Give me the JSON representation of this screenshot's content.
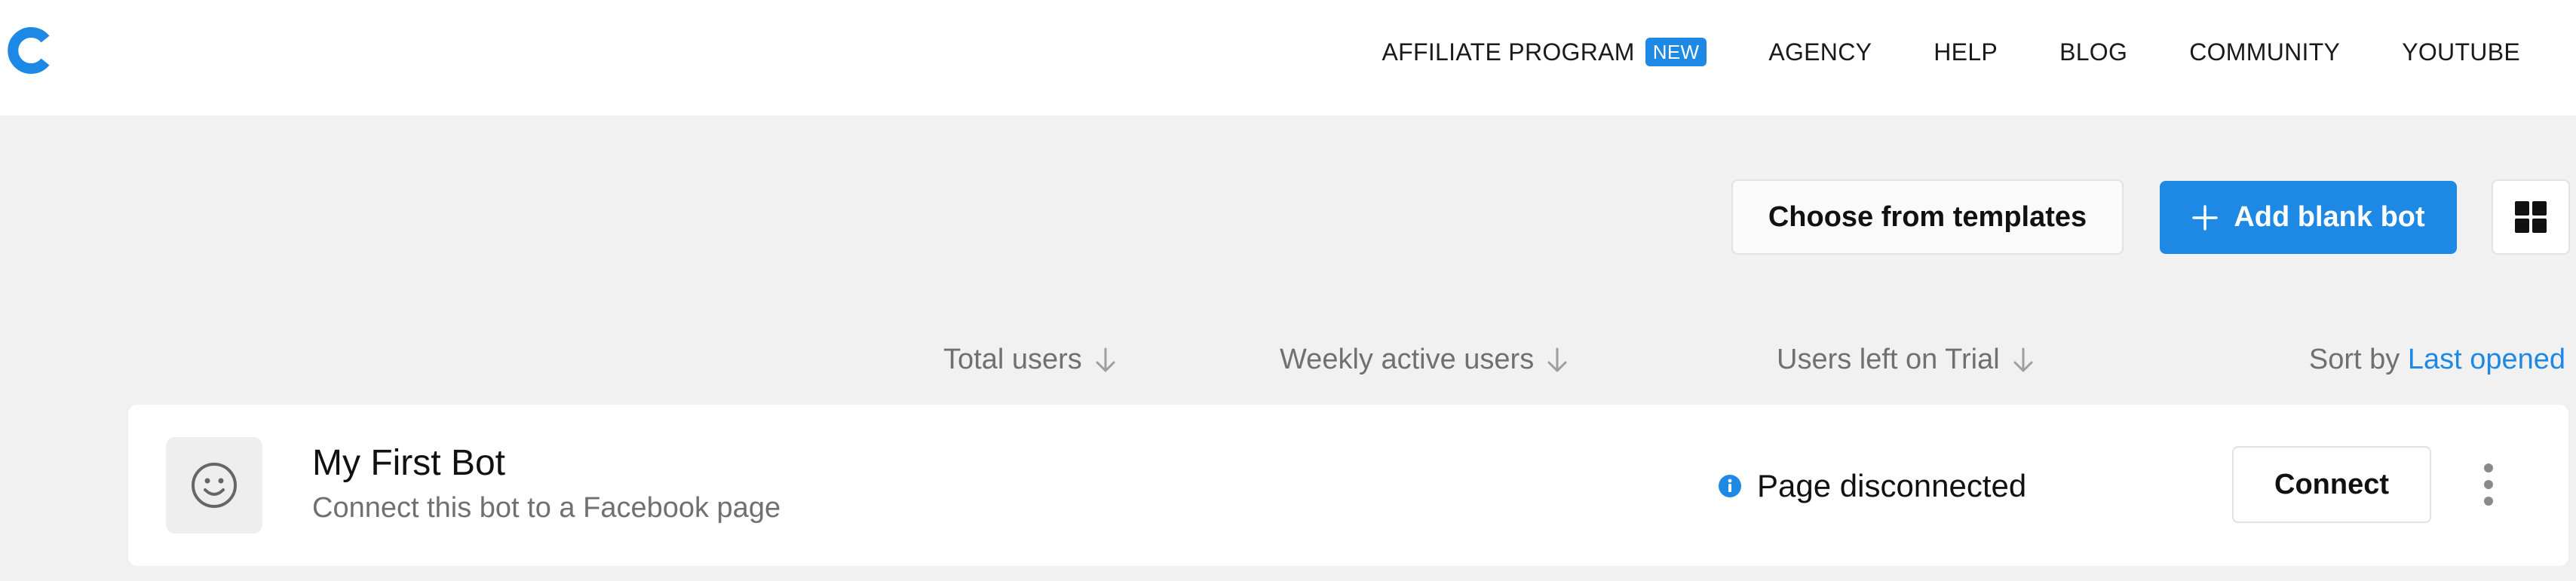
{
  "app": {
    "logo_icon": "chatfuel-c-logo",
    "accent_color": "#1e88e5"
  },
  "nav": {
    "items": [
      {
        "label": "AFFILIATE PROGRAM",
        "badge": "NEW"
      },
      {
        "label": "AGENCY"
      },
      {
        "label": "HELP"
      },
      {
        "label": "BLOG"
      },
      {
        "label": "COMMUNITY"
      },
      {
        "label": "YOUTUBE"
      }
    ]
  },
  "toolbar": {
    "templates_label": "Choose from templates",
    "add_label": "Add blank bot",
    "add_icon": "plus-icon",
    "view_icon": "grid-view-icon"
  },
  "columns": {
    "total_users": "Total users",
    "weekly_active_users": "Weekly active users",
    "users_left_on_trial": "Users left on Trial",
    "sort_icon": "arrow-down-icon"
  },
  "sort": {
    "prefix": "Sort by",
    "value": "Last opened"
  },
  "bots": [
    {
      "name": "My First Bot",
      "subtitle": "Connect this bot to a Facebook page",
      "avatar_icon": "smiley-icon",
      "status_icon": "info-icon",
      "status": "Page disconnected",
      "connect_label": "Connect",
      "more_icon": "more-vertical-icon"
    }
  ]
}
